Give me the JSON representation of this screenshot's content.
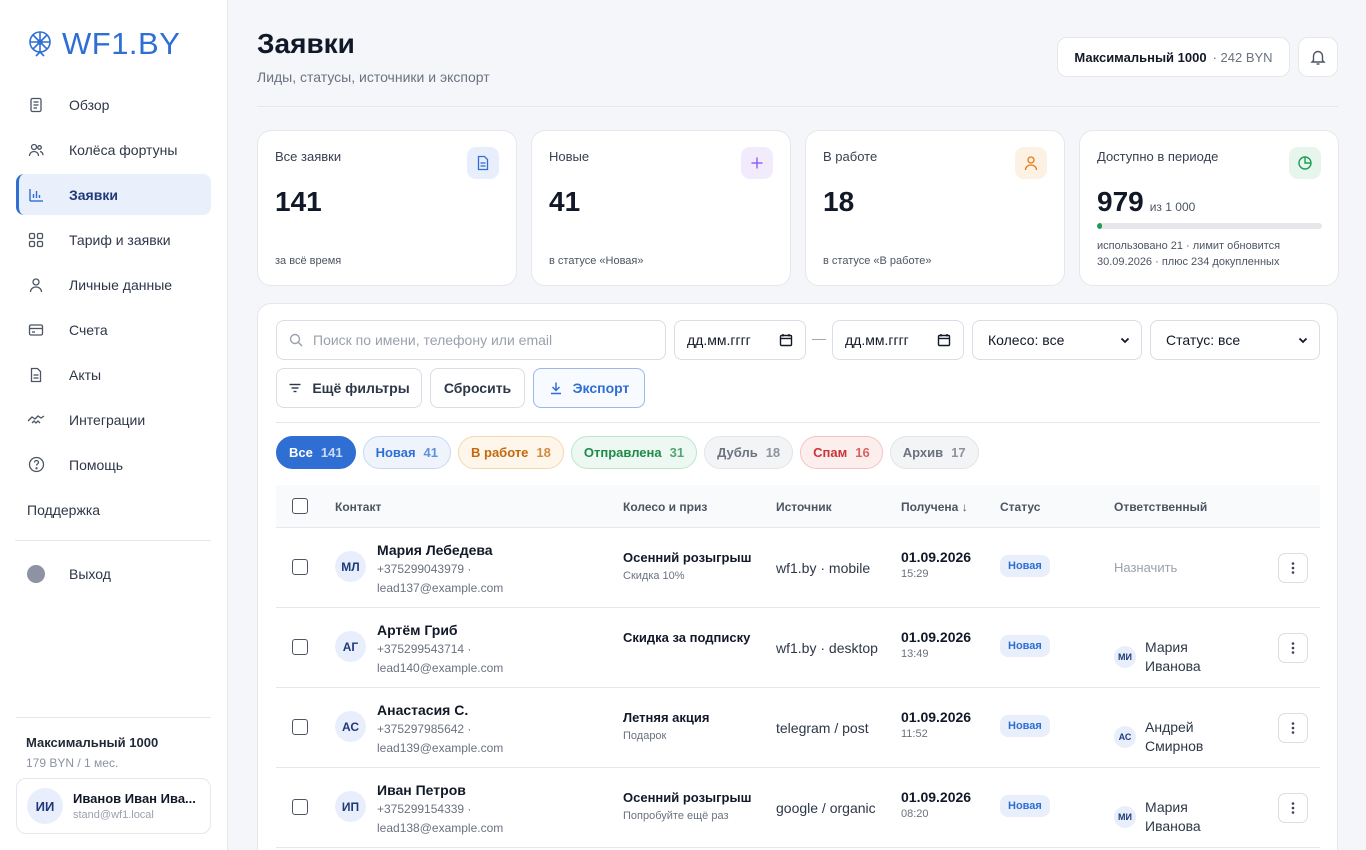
{
  "logo": {
    "text": "WF1.BY",
    "icon": "wheel-icon"
  },
  "nav": [
    {
      "label": "Обзор",
      "icon": "document-icon"
    },
    {
      "label": "Колёса фортуны",
      "icon": "users-icon"
    },
    {
      "label": "Заявки",
      "icon": "bar-chart-icon"
    },
    {
      "label": "Тариф и заявки",
      "icon": "grid-icon"
    },
    {
      "label": "Личные данные",
      "icon": "user-icon"
    },
    {
      "label": "Счета",
      "icon": "card-icon"
    },
    {
      "label": "Акты",
      "icon": "file-icon"
    },
    {
      "label": "Интеграции",
      "icon": "handshake-icon"
    },
    {
      "label": "Помощь",
      "icon": "help-icon"
    }
  ],
  "support_label": "Поддержка",
  "logout_label": "Выход",
  "sidebar_plan": {
    "name": "Максимальный 1000",
    "price": "179 BYN / 1 мес."
  },
  "user": {
    "initials": "ИИ",
    "name": "Иванов Иван Ива...",
    "email": "stand@wf1.local"
  },
  "header": {
    "title": "Заявки",
    "subtitle": "Лиды, статусы, источники и экспорт",
    "plan_name": "Максимальный 1000",
    "plan_price": "· 242 BYN"
  },
  "stats": [
    {
      "label": "Все заявки",
      "value": "141",
      "note": "за всё время",
      "icon": "document-icon"
    },
    {
      "label": "Новые",
      "value": "41",
      "note": "в статусе «Новая»",
      "icon": "plus-icon"
    },
    {
      "label": "В работе",
      "value": "18",
      "note": "в статусе «В работе»",
      "icon": "user-icon"
    },
    {
      "label": "Доступно в периоде",
      "value": "979",
      "of": "из 1 000",
      "note_line1": "использовано 21 · лимит обновится",
      "note_line2": "30.09.2026 · плюс 234 докупленных",
      "icon": "pie-icon",
      "progress": 0.021
    }
  ],
  "filters": {
    "search_placeholder": "Поиск по имени, телефону или email",
    "date_from": "дд.мм.гггг",
    "date_to": "дд.мм.гггг",
    "date_sep": "—",
    "wheel_select": "Колесо: все",
    "status_select": "Статус: все",
    "more_filters": "Ещё фильтры",
    "reset": "Сбросить",
    "export": "Экспорт"
  },
  "chips": [
    {
      "label": "Все",
      "count": "141",
      "bg": "#2f6fd3",
      "border": "#2f6fd3",
      "color": "#ffffff"
    },
    {
      "label": "Новая",
      "count": "41",
      "bg": "#eef3fc",
      "border": "#c9d8f2",
      "color": "#2f6fd3"
    },
    {
      "label": "В работе",
      "count": "18",
      "bg": "#fef6ea",
      "border": "#f3d8ad",
      "color": "#c2680e"
    },
    {
      "label": "Отправлена",
      "count": "31",
      "bg": "#ecf8f1",
      "border": "#bde5cd",
      "color": "#1f8a4c"
    },
    {
      "label": "Дубль",
      "count": "18",
      "bg": "#f3f4f6",
      "border": "#e1e4e9",
      "color": "#6b7280"
    },
    {
      "label": "Спам",
      "count": "16",
      "bg": "#fdeeee",
      "border": "#f3c3c3",
      "color": "#c93535"
    },
    {
      "label": "Архив",
      "count": "17",
      "bg": "#f3f4f6",
      "border": "#e1e4e9",
      "color": "#6b7280"
    }
  ],
  "table": {
    "headers": {
      "contact": "Контакт",
      "wheel": "Колесо и приз",
      "source": "Источник",
      "received": "Получена ↓",
      "status": "Статус",
      "responsible": "Ответственный"
    },
    "rows": [
      {
        "initials": "МЛ",
        "name": "Мария Лебедева",
        "phone": "+375299043979 ·",
        "email": "lead137@example.com",
        "wheel": "Осенний розыгрыш",
        "prize": "Скидка 10%",
        "source": "wf1.by · mobile",
        "date": "01.09.2026",
        "time": "15:29",
        "status": "Новая",
        "assign": "Назначить"
      },
      {
        "initials": "АГ",
        "name": "Артём Гриб",
        "phone": "+375299543714 ·",
        "email": "lead140@example.com",
        "wheel": "Скидка за подписку",
        "prize": "",
        "source": "wf1.by · desktop",
        "date": "01.09.2026",
        "time": "13:49",
        "status": "Новая",
        "resp_initials": "МИ",
        "resp_name": "Мария Иванова"
      },
      {
        "initials": "АС",
        "name": "Анастасия С.",
        "phone": "+375297985642 ·",
        "email": "lead139@example.com",
        "wheel": "Летняя акция",
        "prize": "Подарок",
        "source": "telegram / post",
        "date": "01.09.2026",
        "time": "11:52",
        "status": "Новая",
        "resp_initials": "АС",
        "resp_name": "Андрей Смирнов"
      },
      {
        "initials": "ИП",
        "name": "Иван Петров",
        "phone": "+375299154339 ·",
        "email": "lead138@example.com",
        "wheel": "Осенний розыгрыш",
        "prize": "Попробуйте ещё раз",
        "source": "google / organic",
        "date": "01.09.2026",
        "time": "08:20",
        "status": "Новая",
        "resp_initials": "МИ",
        "resp_name": "Мария Иванова"
      }
    ]
  }
}
